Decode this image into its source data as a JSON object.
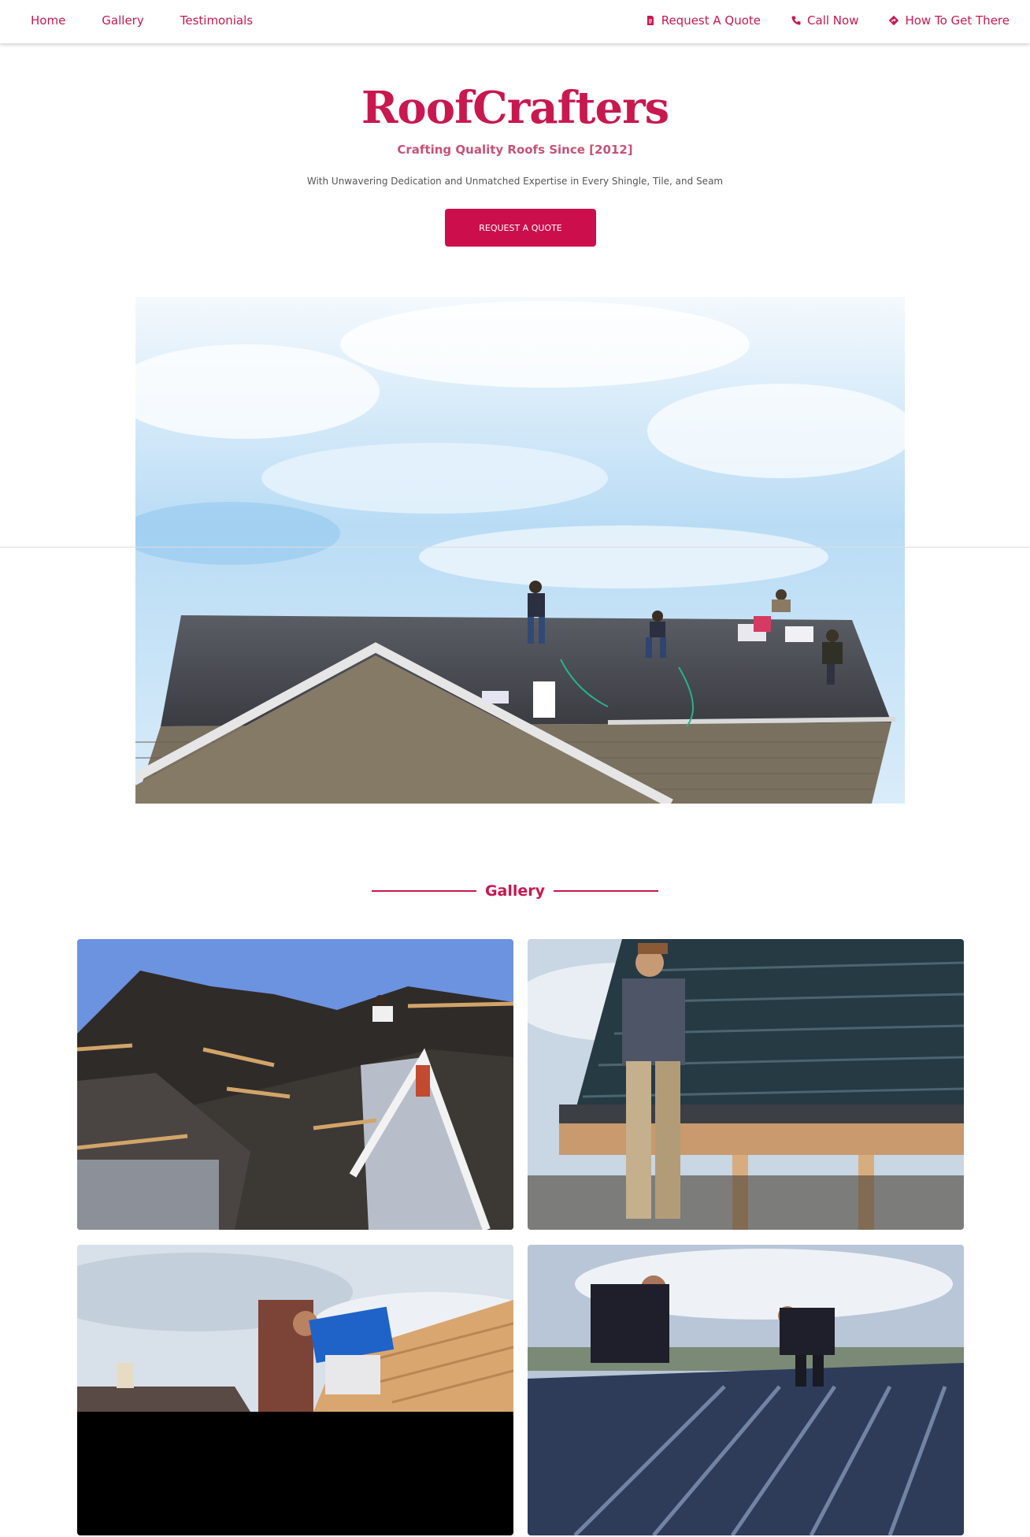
{
  "nav": {
    "left": [
      {
        "label": "Home"
      },
      {
        "label": "Gallery"
      },
      {
        "label": "Testimonials"
      }
    ],
    "right": [
      {
        "label": "Request A Quote",
        "icon": "document-icon"
      },
      {
        "label": "Call Now",
        "icon": "phone-icon"
      },
      {
        "label": "How To Get There",
        "icon": "directions-icon"
      }
    ]
  },
  "hero": {
    "brand": "RoofCrafters",
    "tagline": "Crafting Quality Roofs Since [2012]",
    "subtext": "With Unwavering Dedication and Unmatched Expertise in Every Shingle, Tile, and Seam",
    "cta_label": "REQUEST A QUOTE"
  },
  "gallery": {
    "heading": "Gallery"
  },
  "colors": {
    "accent": "#c8184f",
    "button": "#cc0f4c",
    "tagline": "#c95277"
  }
}
